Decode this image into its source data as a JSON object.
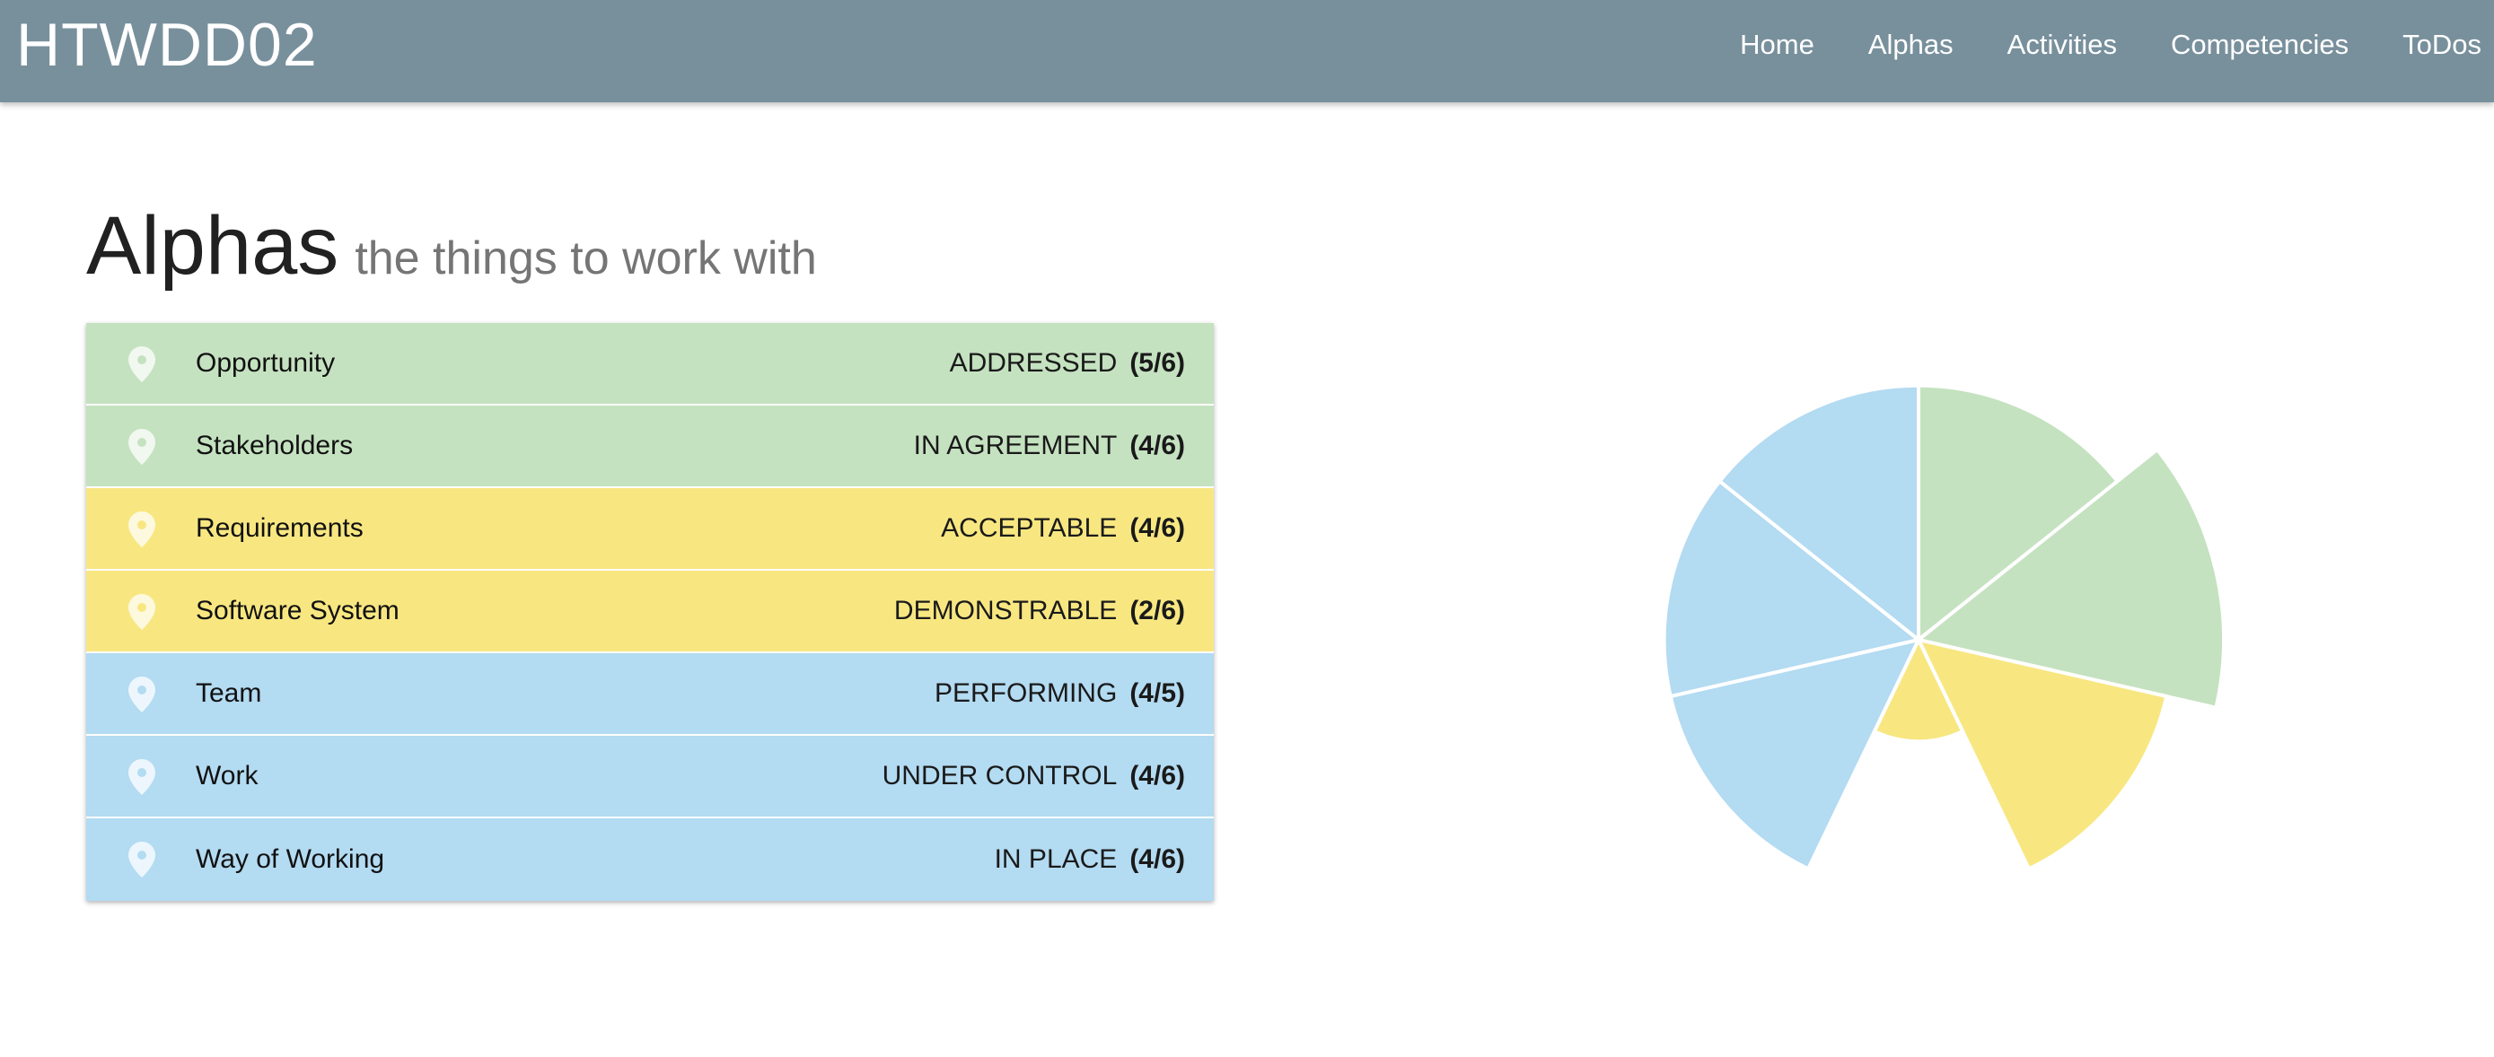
{
  "app": {
    "brand": "HTWDD02"
  },
  "nav": {
    "items": [
      {
        "label": "Home"
      },
      {
        "label": "Alphas"
      },
      {
        "label": "Activities"
      },
      {
        "label": "Competencies"
      },
      {
        "label": "ToDos"
      }
    ]
  },
  "header": {
    "title": "Alphas",
    "subtitle": "the things to work with"
  },
  "colors": {
    "navbar": "#78909c",
    "green": "#c5e2c0",
    "yellow": "#f8e781",
    "blue": "#b3dbf2"
  },
  "alphas": [
    {
      "name": "Opportunity",
      "state": "ADDRESSED",
      "progress": "(5/6)",
      "color": "#c5e2c0",
      "icon": "map-marker-icon"
    },
    {
      "name": "Stakeholders",
      "state": "IN AGREEMENT",
      "progress": "(4/6)",
      "color": "#c5e2c0",
      "icon": "map-marker-icon"
    },
    {
      "name": "Requirements",
      "state": "ACCEPTABLE",
      "progress": "(4/6)",
      "color": "#f8e781",
      "icon": "map-marker-icon"
    },
    {
      "name": "Software System",
      "state": "DEMONSTRABLE",
      "progress": "(2/6)",
      "color": "#f8e781",
      "icon": "map-marker-icon"
    },
    {
      "name": "Team",
      "state": "PERFORMING",
      "progress": "(4/5)",
      "color": "#b3dbf2",
      "icon": "map-marker-icon"
    },
    {
      "name": "Work",
      "state": "UNDER CONTROL",
      "progress": "(4/6)",
      "color": "#b3dbf2",
      "icon": "map-marker-icon"
    },
    {
      "name": "Way of Working",
      "state": "IN PLACE",
      "progress": "(4/6)",
      "color": "#b3dbf2",
      "icon": "map-marker-icon"
    }
  ],
  "chart_data": {
    "type": "polar-area",
    "categories": [
      "Opportunity",
      "Stakeholders",
      "Requirements",
      "Software System",
      "Team",
      "Work",
      "Way of Working"
    ],
    "values": [
      5,
      6,
      5,
      2,
      5,
      5,
      5
    ],
    "max": 6,
    "colors": [
      "#c5e2c0",
      "#c5e2c0",
      "#f8e781",
      "#f8e781",
      "#b3dbf2",
      "#b3dbf2",
      "#b3dbf2"
    ]
  }
}
